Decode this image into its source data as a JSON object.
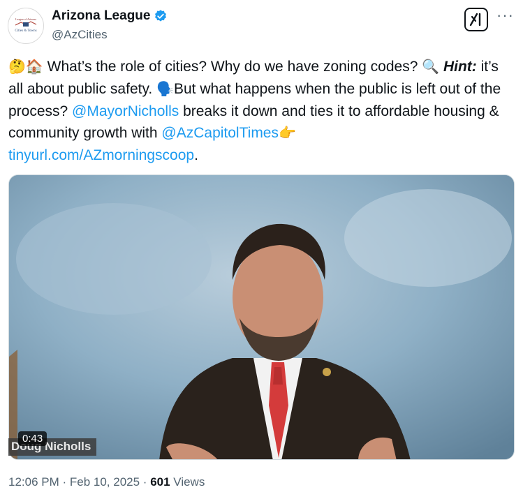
{
  "account": {
    "name": "Arizona League",
    "handle": "@AzCities",
    "verified": true,
    "avatar_text": "Cities & Towns",
    "avatar_subtext": "League of Arizona"
  },
  "tweet": {
    "emoji_lead": "🤔🏠",
    "part1": " What’s the role of cities? Why do we have zoning codes? ",
    "emoji_search": "🔍",
    "hint_label": "Hint:",
    "part2": " it’s all about public safety. ",
    "emoji_speak": "🗣️",
    "part3": "But what happens when the public is left out of the process? ",
    "mention1": "@MayorNicholls",
    "part4": " breaks it down and ties it to affordable housing & community growth with ",
    "mention2": "@AzCapitolTimes",
    "emoji_point": "👉",
    "link": "tinyurl.com/AZmorningscoop",
    "part5": "."
  },
  "video": {
    "duration": "0:43",
    "caption": "Doug Nicholls"
  },
  "meta": {
    "time": "12:06 PM",
    "sep1": " · ",
    "date": "Feb 10, 2025",
    "sep2": " · ",
    "views_count": "601",
    "views_label": " Views"
  },
  "colors": {
    "link": "#1d9bf0",
    "verified": "#1d9bf0",
    "secondary_text": "#536471"
  }
}
